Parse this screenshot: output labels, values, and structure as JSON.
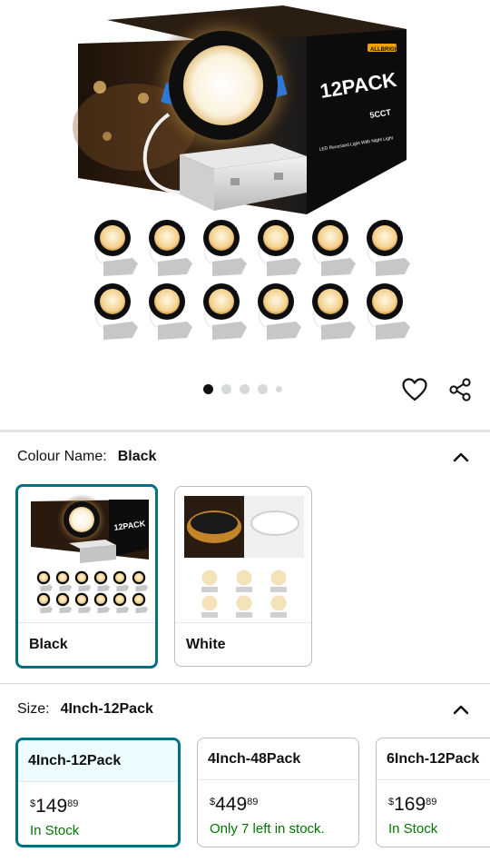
{
  "product": {
    "box_text": "12PACK",
    "box_sub": "5CCT",
    "box_caption": "LED Recessed Light With Night Light",
    "box_brand": "ALLBRIGHT"
  },
  "carousel": {
    "total": 5,
    "active": 0
  },
  "colour": {
    "label": "Colour Name:",
    "value": "Black",
    "options": [
      {
        "name": "Black",
        "thumb_text": "12PACK"
      },
      {
        "name": "White"
      }
    ]
  },
  "size": {
    "label": "Size:",
    "value": "4Inch-12Pack",
    "options": [
      {
        "name": "4Inch-12Pack",
        "symbol": "$",
        "whole": "149",
        "fraction": "89",
        "stock": "In Stock"
      },
      {
        "name": "4Inch-48Pack",
        "symbol": "$",
        "whole": "449",
        "fraction": "89",
        "stock": "Only 7 left in stock."
      },
      {
        "name": "6Inch-12Pack",
        "symbol": "$",
        "whole": "169",
        "fraction": "89",
        "stock": "In Stock"
      }
    ]
  },
  "colors": {
    "accent": "#007185",
    "in_stock": "#007600",
    "selected_bg": "#edfdff"
  }
}
